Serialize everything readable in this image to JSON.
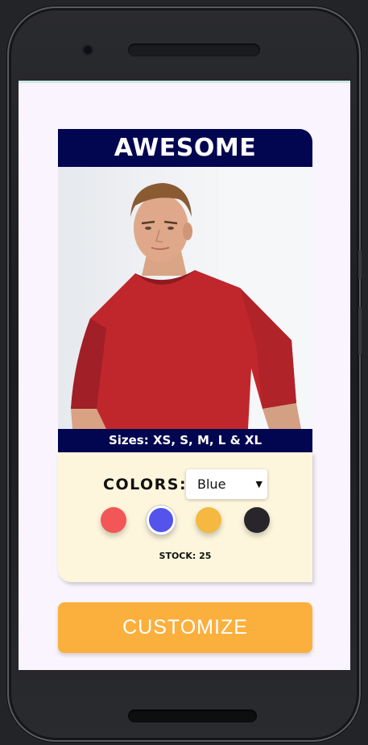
{
  "product": {
    "title": "AWESOME",
    "sizes": "Sizes: XS, S, M, L & XL",
    "colors_label": "COLORS:",
    "selected_color": "Blue",
    "swatches": [
      {
        "name": "red",
        "hex": "#f35656"
      },
      {
        "name": "blue",
        "hex": "#5454ec",
        "selected": true
      },
      {
        "name": "yellow",
        "hex": "#f5b942"
      },
      {
        "name": "black",
        "hex": "#28262a"
      }
    ],
    "stock": "STOCK: 25",
    "photo": "man-in-red-tshirt"
  },
  "actions": {
    "customize_label": "CUSTOMIZE"
  },
  "theme": {
    "navy": "#020550",
    "cream": "#fdf6dc",
    "orange": "#fbb03d"
  }
}
